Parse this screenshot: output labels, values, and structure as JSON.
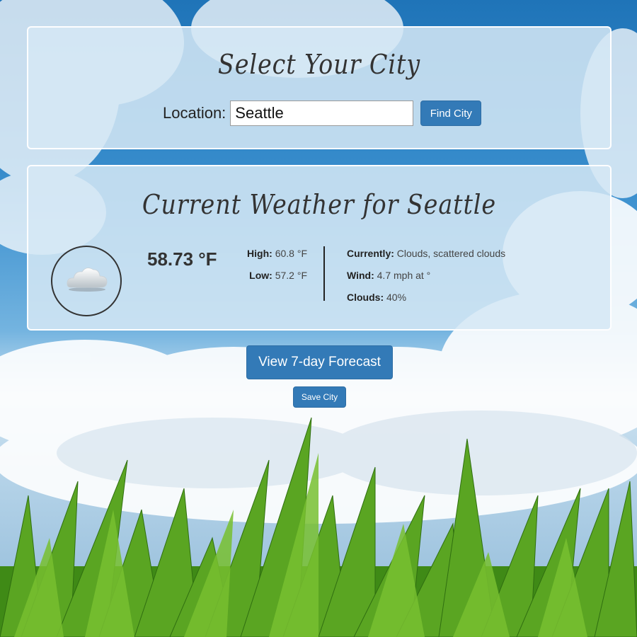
{
  "city_panel": {
    "title": "Select Your City",
    "location_label": "Location:",
    "location_value": "Seattle",
    "find_button": "Find City"
  },
  "weather_panel": {
    "title": "Current Weather for Seattle",
    "icon": "cloud-icon",
    "temperature": "58.73 °F",
    "high_label": "High:",
    "high_value": "60.8 °F",
    "low_label": "Low:",
    "low_value": "57.2 °F",
    "currently_label": "Currently:",
    "currently_value": "Clouds, scattered clouds",
    "wind_label": "Wind:",
    "wind_value": "4.7 mph at °",
    "clouds_label": "Clouds:",
    "clouds_value": "40%"
  },
  "actions": {
    "forecast_button": "View 7-day Forecast",
    "save_button": "Save City"
  },
  "colors": {
    "button": "#337ab7",
    "panel": "#d5e8f4",
    "grass": "#4f9a1c"
  }
}
